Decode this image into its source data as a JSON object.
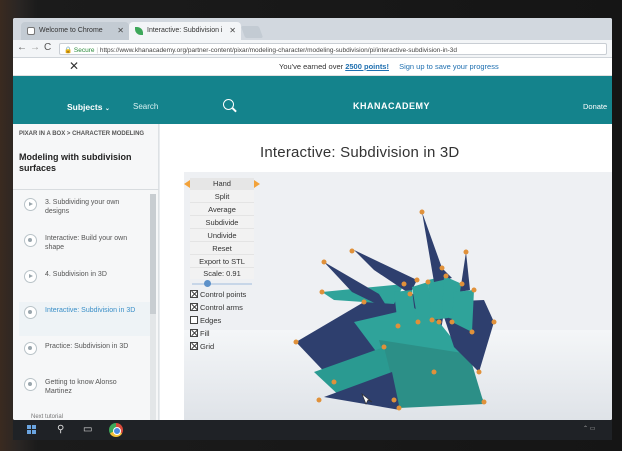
{
  "tabs": [
    {
      "label": "Welcome to Chrome",
      "active": false
    },
    {
      "label": "Interactive: Subdivision i",
      "active": true
    }
  ],
  "address": {
    "secure_label": "Secure",
    "url": "https://www.khanacademy.org/partner-content/pixar/modeling-character/modeling-subdivision/pi/interactive-subdivision-in-3d"
  },
  "notice": {
    "prefix": "You've earned over",
    "points": "2500 points!",
    "signup": "Sign up to save your progress"
  },
  "header": {
    "subjects": "Subjects",
    "search": "Search",
    "logo": "KHANACADEMY",
    "donate": "Donate"
  },
  "sidebar": {
    "breadcrumb": "PIXAR IN A BOX > CHARACTER MODELING",
    "unit_title": "Modeling with subdivision surfaces",
    "items": [
      {
        "label": "3. Subdividing your own designs",
        "kind": "play"
      },
      {
        "label": "Interactive: Build your own shape",
        "kind": "dot"
      },
      {
        "label": "4. Subdivision in 3D",
        "kind": "play"
      },
      {
        "label": "Interactive: Subdivision in 3D",
        "kind": "dot",
        "active": true
      },
      {
        "label": "Practice: Subdivision in 3D",
        "kind": "dot"
      },
      {
        "label": "Getting to know Alonso Martinez",
        "kind": "dot"
      }
    ],
    "next_tutorial": "Next tutorial"
  },
  "main": {
    "title": "Interactive: Subdivision in 3D"
  },
  "controls": {
    "model": "Hand",
    "buttons": [
      "Split",
      "Average",
      "Subdivide",
      "Undivide",
      "Reset",
      "Export to STL"
    ],
    "scale_label": "Scale: 0.91",
    "scale_value": 0.91,
    "checkboxes": [
      {
        "label": "Control points",
        "checked": true
      },
      {
        "label": "Control arms",
        "checked": true
      },
      {
        "label": "Edges",
        "checked": false
      },
      {
        "label": "Fill",
        "checked": true
      },
      {
        "label": "Grid",
        "checked": true
      }
    ]
  },
  "colors": {
    "ka_teal": "#14838c",
    "mesh_teal": "#2fa39a",
    "mesh_dark": "#2e3f6e",
    "control_point": "#e0913a",
    "accent_orange": "#f2a23a"
  },
  "icons": {
    "taskbar": [
      "windows-icon",
      "search-icon",
      "task-view-icon",
      "chrome-icon"
    ]
  }
}
